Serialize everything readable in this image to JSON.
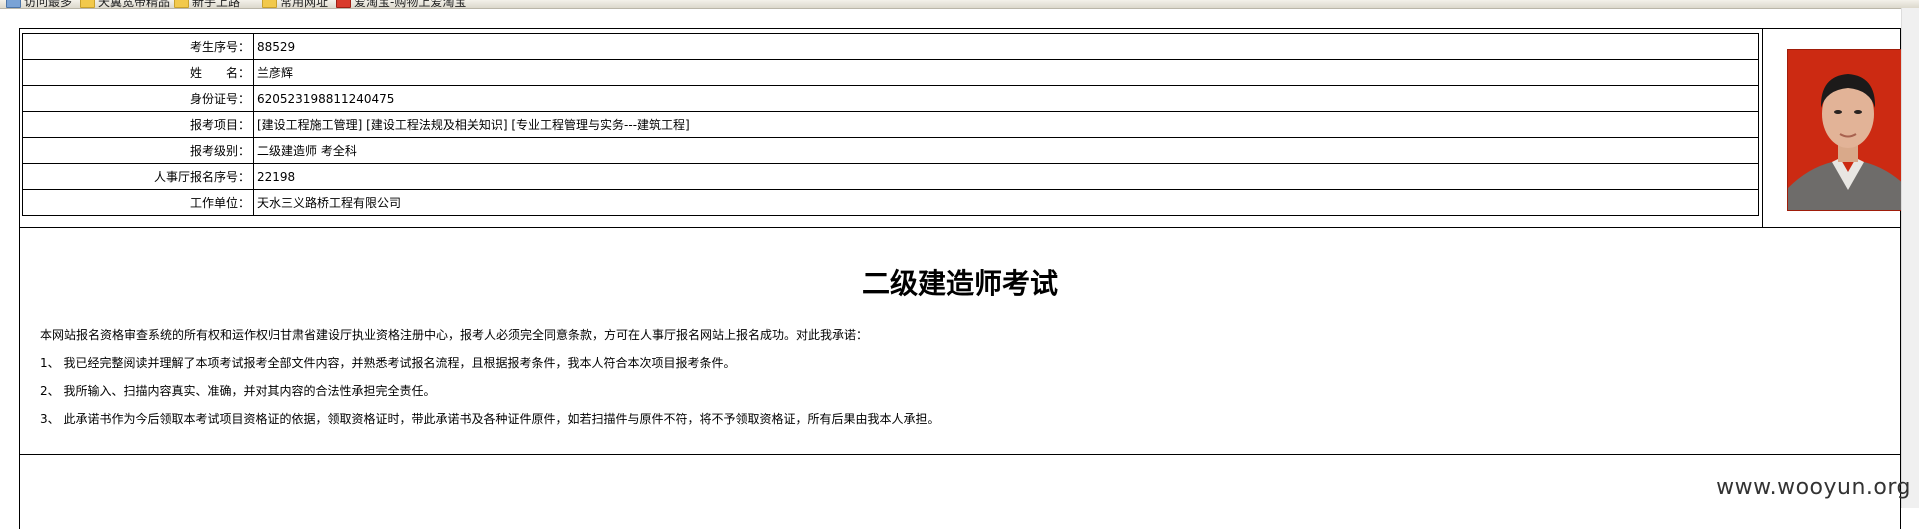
{
  "bookmarks": [
    {
      "label": "访问最多",
      "icon": "page-icon"
    },
    {
      "label": "天翼宽带精品",
      "icon": "folder-icon"
    },
    {
      "label": "新手上路",
      "icon": "folder-icon"
    },
    {
      "label": "常用网址",
      "icon": "folder-icon"
    },
    {
      "label": "爱淘宝-购物上爱淘宝",
      "icon": "red-icon"
    }
  ],
  "applicant": {
    "rows": [
      {
        "label": "考生序号：",
        "value": "88529"
      },
      {
        "label": "姓　　名：",
        "value": "兰彦辉"
      },
      {
        "label": "身份证号：",
        "value": "620523198811240475"
      },
      {
        "label": "报考项目：",
        "value": "[建设工程施工管理] [建设工程法规及相关知识] [专业工程管理与实务---建筑工程]"
      },
      {
        "label": "报考级别：",
        "value": "二级建造师 考全科"
      },
      {
        "label": "人事厅报名序号：",
        "value": "22198"
      },
      {
        "label": "工作单位：",
        "value": "天水三义路桥工程有限公司"
      }
    ],
    "photo_bg": "#cc2a12"
  },
  "statement": {
    "title": "二级建造师考试",
    "intro": "本网站报名资格审查系统的所有权和运作权归甘肃省建设厅执业资格注册中心，报考人必须完全同意条款，方可在人事厅报名网站上报名成功。对此我承诺：",
    "items": [
      "1、 我已经完整阅读并理解了本项考试报考全部文件内容，并熟悉考试报名流程，且根据报考条件，我本人符合本次项目报考条件。",
      "2、 我所输入、扫描内容真实、准确，并对其内容的合法性承担完全责任。",
      "3、 此承诺书作为今后领取本考试项目资格证的依据，领取资格证时，带此承诺书及各种证件原件，如若扫描件与原件不符，将不予领取资格证，所有后果由我本人承担。"
    ]
  },
  "watermark": "www.wooyun.org"
}
